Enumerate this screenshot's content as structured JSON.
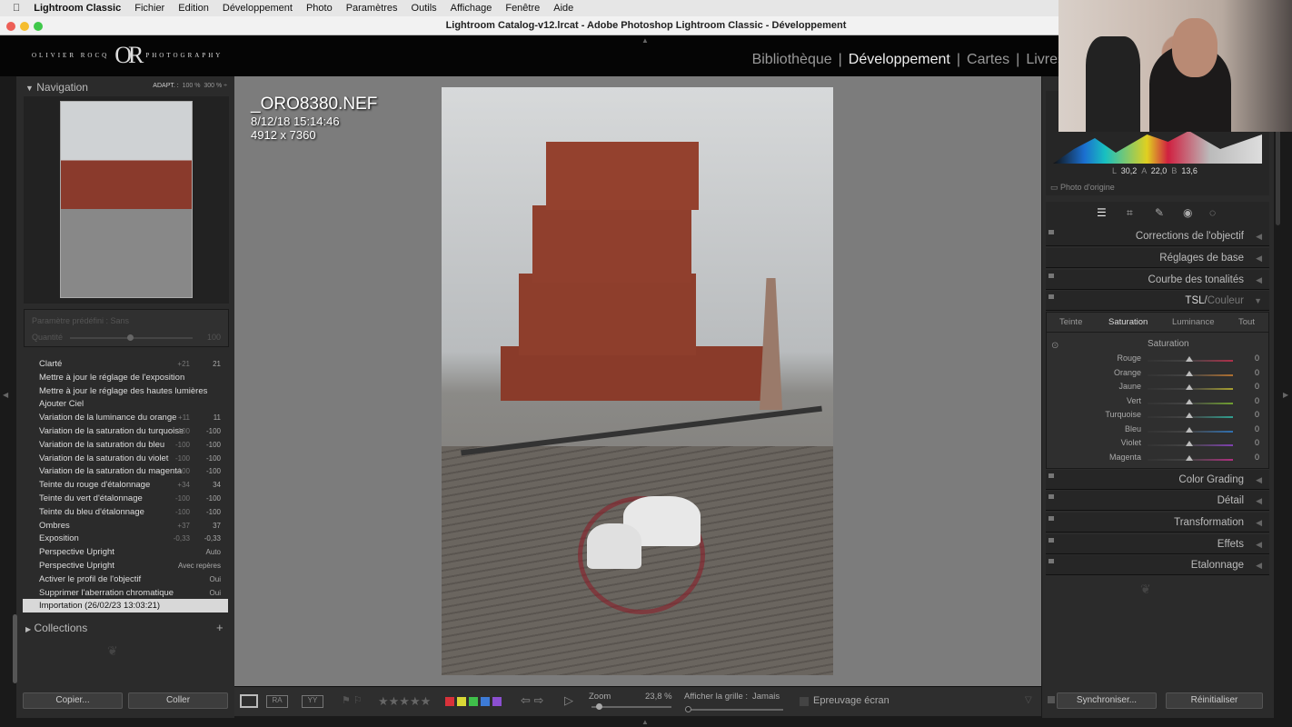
{
  "menubar": {
    "app": "Lightroom Classic",
    "items": [
      "Fichier",
      "Edition",
      "Développement",
      "Photo",
      "Paramètres",
      "Outils",
      "Affichage",
      "Fenêtre",
      "Aide"
    ]
  },
  "window_title": "Lightroom Catalog-v12.lrcat - Adobe Photoshop Lightroom Classic - Développement",
  "identity": {
    "left": "OLIVIER ROCQ",
    "mark": "OR",
    "right": "PHOTOGRAPHY"
  },
  "modules": [
    {
      "label": "Bibliothèque"
    },
    {
      "label": "Développement",
      "active": true
    },
    {
      "label": "Cartes"
    },
    {
      "label": "Livres"
    }
  ],
  "navigator": {
    "title": "Navigation",
    "zoom_options": [
      "ADAPT. :",
      "100 %",
      "300 %"
    ]
  },
  "preset": {
    "label": "Paramètre prédéfini : Sans",
    "amount_label": "Quantité",
    "amount": "100"
  },
  "history": [
    {
      "label": "Clarté",
      "before": "+21",
      "after": "21"
    },
    {
      "label": "Mettre à jour le réglage de l'exposition"
    },
    {
      "label": "Mettre à jour le réglage des hautes lumières"
    },
    {
      "label": "Ajouter Ciel"
    },
    {
      "label": "Variation de la luminance du orange",
      "before": "+11",
      "after": "11"
    },
    {
      "label": "Variation de la saturation du turquoise",
      "before": "-100",
      "after": "-100"
    },
    {
      "label": "Variation de la saturation du bleu",
      "before": "-100",
      "after": "-100"
    },
    {
      "label": "Variation de la saturation du violet",
      "before": "-100",
      "after": "-100"
    },
    {
      "label": "Variation de la saturation du magenta",
      "before": "-100",
      "after": "-100"
    },
    {
      "label": "Teinte du rouge d'étalonnage",
      "before": "+34",
      "after": "34"
    },
    {
      "label": "Teinte du vert d'étalonnage",
      "before": "-100",
      "after": "-100"
    },
    {
      "label": "Teinte du bleu d'étalonnage",
      "before": "-100",
      "after": "-100"
    },
    {
      "label": "Ombres",
      "before": "+37",
      "after": "37"
    },
    {
      "label": "Exposition",
      "before": "-0,33",
      "after": "-0,33"
    },
    {
      "label": "Perspective Upright",
      "after": "Auto"
    },
    {
      "label": "Perspective Upright",
      "after": "Avec repères"
    },
    {
      "label": "Activer le profil de l'objectif",
      "after": "Oui"
    },
    {
      "label": "Supprimer l'aberration chromatique",
      "after": "Oui"
    },
    {
      "label": "Importation (26/02/23 13:03:21)",
      "selected": true
    }
  ],
  "collections": {
    "title": "Collections",
    "add": "+"
  },
  "left_buttons": {
    "copy": "Copier...",
    "paste": "Coller"
  },
  "photo_info": {
    "filename": "_ORO8380.NEF",
    "date": "8/12/18 15:14:46",
    "dimensions": "4912 x 7360"
  },
  "toolbar": {
    "zoom_label": "Zoom",
    "zoom_value": "23,8 %",
    "grid_label": "Afficher la grille :",
    "grid_value": "Jamais",
    "softproof": "Epreuvage écran",
    "color_labels": [
      "#d8323a",
      "#d9d836",
      "#3fbf4a",
      "#3d7bd6",
      "#8b4fd0"
    ],
    "stars": "★★★★★"
  },
  "histogram": {
    "L_label": "L",
    "L": "30,2",
    "A_label": "A",
    "A": "22,0",
    "B_label": "B",
    "B": "13,6",
    "original": "Photo d'origine"
  },
  "sections": {
    "lens": "Corrections de l'objectif",
    "basic": "Réglages de base",
    "curve": "Courbe des tonalités",
    "hsl": "TSL",
    "color": "Couleur",
    "grading": "Color Grading",
    "detail": "Détail",
    "transform": "Transformation",
    "effects": "Effets",
    "calibration": "Etalonnage"
  },
  "hsl_tabs": [
    "Teinte",
    "Saturation",
    "Luminance",
    "Tout"
  ],
  "hsl_title": "Saturation",
  "hsl_sliders": [
    {
      "label": "Rouge",
      "value": "0",
      "color": "#b0304a"
    },
    {
      "label": "Orange",
      "value": "0",
      "color": "#b07030"
    },
    {
      "label": "Jaune",
      "value": "0",
      "color": "#a8a030"
    },
    {
      "label": "Vert",
      "value": "0",
      "color": "#70a030"
    },
    {
      "label": "Turquoise",
      "value": "0",
      "color": "#30a090"
    },
    {
      "label": "Bleu",
      "value": "0",
      "color": "#3070b0"
    },
    {
      "label": "Violet",
      "value": "0",
      "color": "#8040b0"
    },
    {
      "label": "Magenta",
      "value": "0",
      "color": "#b03080"
    }
  ],
  "right_buttons": {
    "sync": "Synchroniser...",
    "reset": "Réinitialiser"
  }
}
